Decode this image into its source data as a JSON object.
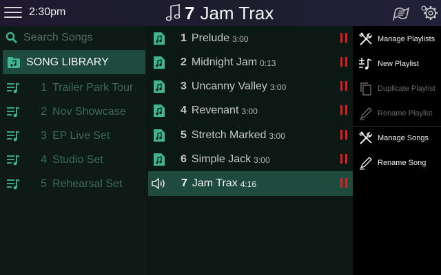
{
  "header": {
    "time": "2:30pm",
    "playlist_number": "7",
    "playlist_title": "Jam Trax",
    "icons": [
      "menu-icon",
      "music-note-icon",
      "playlist-flag-icon",
      "settings-gear-icon"
    ]
  },
  "search": {
    "placeholder": "Search Songs"
  },
  "library": {
    "label": "SONG LIBRARY"
  },
  "playlists": [
    {
      "num": "1",
      "name": "Trailer Park Tour"
    },
    {
      "num": "2",
      "name": "Nov Showcase"
    },
    {
      "num": "3",
      "name": "EP Live Set"
    },
    {
      "num": "4",
      "name": "Studio Set"
    },
    {
      "num": "5",
      "name": "Rehearsal Set"
    }
  ],
  "songs": [
    {
      "num": "1",
      "name": "Prelude",
      "duration": "3:00"
    },
    {
      "num": "2",
      "name": "Midnight Jam",
      "duration": "0:13"
    },
    {
      "num": "3",
      "name": "Uncanny Valley",
      "duration": "3:00"
    },
    {
      "num": "4",
      "name": "Revenant",
      "duration": "3:00"
    },
    {
      "num": "5",
      "name": "Stretch Marked",
      "duration": "3:00"
    },
    {
      "num": "6",
      "name": "Simple Jack",
      "duration": "3:00"
    },
    {
      "num": "7",
      "name": "Jam Trax",
      "duration": "4:16",
      "playing": true
    }
  ],
  "menu": {
    "manage_playlists": "Manage Playlists",
    "new_playlist": "New Playlist",
    "duplicate_playlist": "Duplicate Playlist",
    "rename_playlist": "Rename Playlist",
    "manage_songs": "Manage Songs",
    "rename_song": "Rename Song"
  },
  "colors": {
    "accent": "#1e4b3d",
    "pause": "#e02020",
    "icon_teal": "#3fb58f"
  }
}
